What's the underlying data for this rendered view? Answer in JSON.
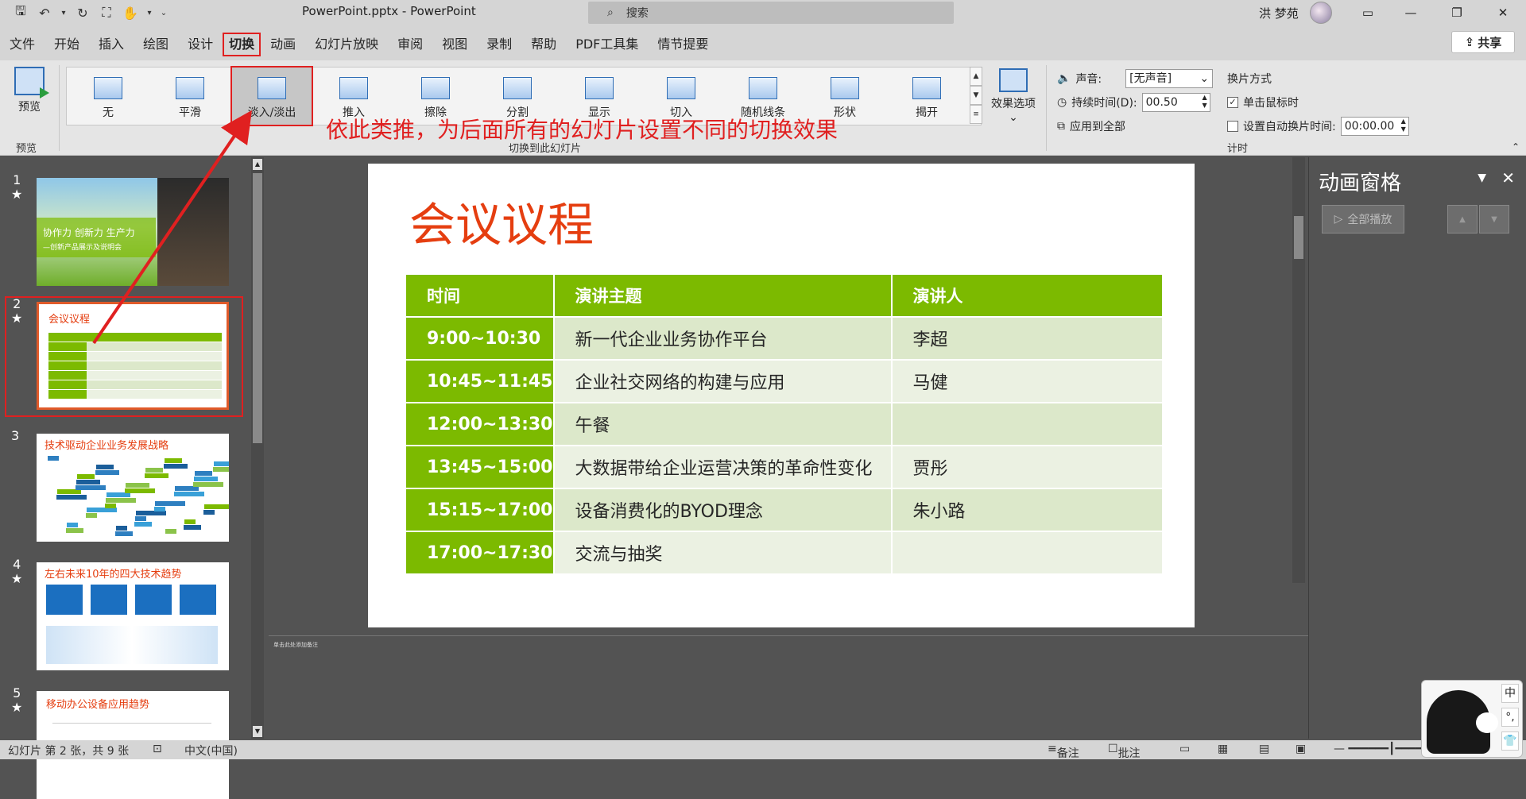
{
  "window": {
    "title": "PowerPoint.pptx - PowerPoint",
    "search_placeholder": "搜索",
    "user": "洪 梦苑"
  },
  "qat": {
    "save": "🖫",
    "undo": "↶",
    "redo": "↻"
  },
  "menu": [
    "文件",
    "开始",
    "插入",
    "绘图",
    "设计",
    "切换",
    "动画",
    "幻灯片放映",
    "审阅",
    "视图",
    "录制",
    "帮助",
    "PDF工具集",
    "情节提要"
  ],
  "menu_active": "切换",
  "share": "共享",
  "ribbon": {
    "preview_label": "预览",
    "preview_group": "预览",
    "transitions": [
      "无",
      "平滑",
      "淡入/淡出",
      "推入",
      "擦除",
      "分割",
      "显示",
      "切入",
      "随机线条",
      "形状",
      "揭开"
    ],
    "selected_transition": "淡入/淡出",
    "transition_group": "切换到此幻灯片",
    "effect_options": "效果选项",
    "sound_label": "声音:",
    "sound_value": "[无声音]",
    "duration_label": "持续时间(D):",
    "duration_value": "00.50",
    "apply_all": "应用到全部",
    "switch_mode": "换片方式",
    "on_click": "单击鼠标时",
    "auto_after": "设置自动换片时间:",
    "auto_value": "00:00.00",
    "timing_group": "计时"
  },
  "annotation": "依此类推，为后面所有的幻灯片设置不同的切换效果",
  "thumbnails": [
    {
      "num": "1",
      "star": "★",
      "text": "协作力  创新力  生产力",
      "sub": "—创新产品展示及说明会"
    },
    {
      "num": "2",
      "star": "★",
      "text": "会议议程"
    },
    {
      "num": "3",
      "star": "",
      "text": "技术驱动企业业务发展战略"
    },
    {
      "num": "4",
      "star": "★",
      "text": "左右未来10年的四大技术趋势"
    },
    {
      "num": "5",
      "star": "★",
      "text": "移动办公设备应用趋势"
    }
  ],
  "slide": {
    "title": "会议议程",
    "headers": [
      "时间",
      "演讲主题",
      "演讲人"
    ],
    "rows": [
      [
        "9:00~10:30",
        "新一代企业业务协作平台",
        "李超"
      ],
      [
        "10:45~11:45",
        "企业社交网络的构建与应用",
        "马健"
      ],
      [
        "12:00~13:30",
        "午餐",
        ""
      ],
      [
        "13:45~15:00",
        "大数据带给企业运营决策的革命性变化",
        "贾彤"
      ],
      [
        "15:15~17:00",
        "设备消费化的BYOD理念",
        "朱小路"
      ],
      [
        "17:00~17:30",
        "交流与抽奖",
        ""
      ]
    ]
  },
  "notes_placeholder": "单击此处添加备注",
  "anim_pane": {
    "title": "动画窗格",
    "play_all": "全部播放"
  },
  "status": {
    "slide_info": "幻灯片 第 2 张，共 9 张",
    "language": "中文(中国)",
    "notes": "备注",
    "comments": "批注"
  },
  "ime": {
    "mode": "中",
    "punct": "°,",
    "skin": "👕"
  },
  "colors": {
    "accent_red": "#e02020",
    "table_green": "#7cba00",
    "title_orange": "#e53e10"
  }
}
